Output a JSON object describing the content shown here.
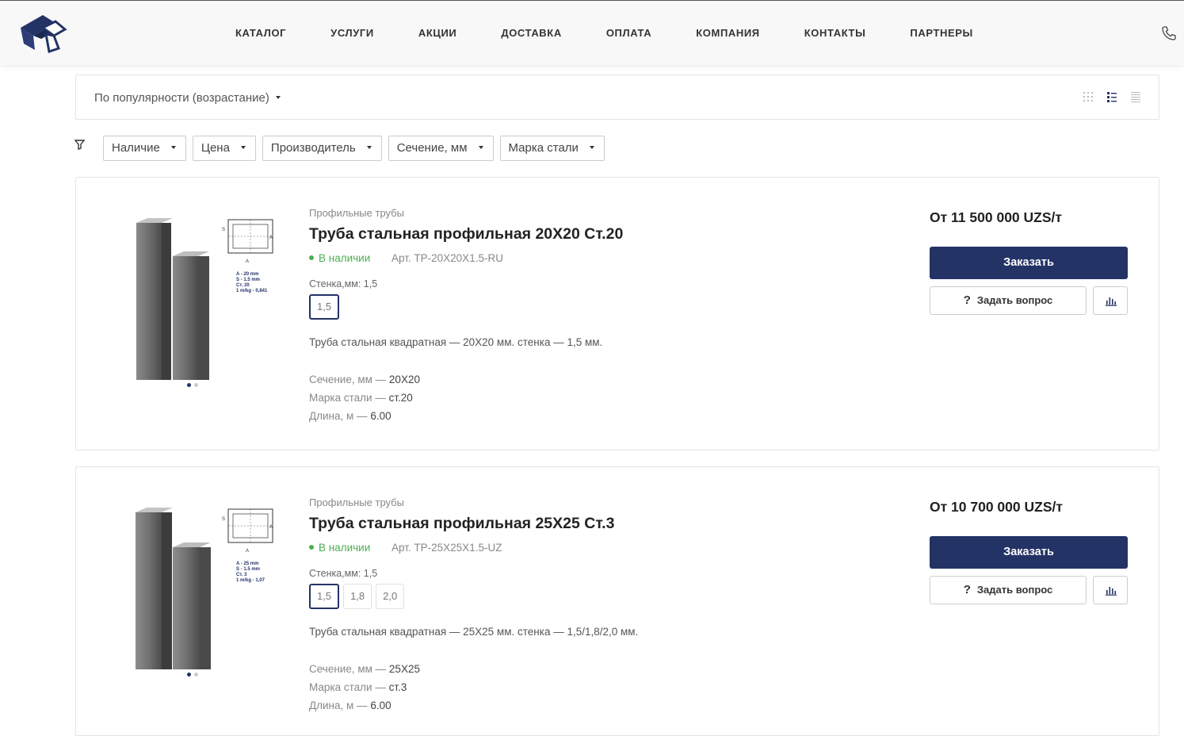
{
  "nav": {
    "items": [
      "КАТАЛОГ",
      "УСЛУГИ",
      "АКЦИИ",
      "ДОСТАВКА",
      "ОПЛАТА",
      "КОМПАНИЯ",
      "КОНТАКТЫ",
      "ПАРТНЕРЫ"
    ]
  },
  "sort": {
    "label": "По популярности (возрастание)",
    "views": [
      "grid-view-icon",
      "list-view-icon",
      "compact-list-icon"
    ],
    "active_view": "list-view-icon"
  },
  "filters": [
    "Наличие",
    "Цена",
    "Производитель",
    "Сечение, мм",
    "Марка стали"
  ],
  "colors": {
    "primary": "#243366",
    "in_stock": "#4caf50"
  },
  "products": [
    {
      "category": "Профильные трубы",
      "title": "Труба стальная профильная 20Х20 Ст.20",
      "stock": "В наличии",
      "article": "Арт. TP-20X20X1.5-RU",
      "prop_label": "Стенка,мм: 1,5",
      "variants": [
        "1,5"
      ],
      "selected_variant": "1,5",
      "description": "Труба стальная квадратная — 20Х20 мм. стенка — 1,5 мм.",
      "specs": [
        {
          "label": "Сечение, мм — ",
          "value": "20Х20"
        },
        {
          "label": "Марка стали — ",
          "value": "ст.20"
        },
        {
          "label": "Длина, м — ",
          "value": "6.00"
        }
      ],
      "image_caption": [
        "A - 20 mm",
        "S - 1.5 mm",
        "Ст. 20",
        "1 m/kg - 0,841"
      ],
      "price": "От 11 500 000 UZS/т",
      "order_label": "Заказать",
      "ask_label": "Задать вопрос"
    },
    {
      "category": "Профильные трубы",
      "title": "Труба стальная профильная 25Х25 Ст.3",
      "stock": "В наличии",
      "article": "Арт. TP-25X25X1.5-UZ",
      "prop_label": "Стенка,мм: 1,5",
      "variants": [
        "1,5",
        "1,8",
        "2,0"
      ],
      "selected_variant": "1,5",
      "description": "Труба стальная квадратная — 25Х25 мм. стенка — 1,5/1,8/2,0 мм.",
      "specs": [
        {
          "label": "Сечение, мм — ",
          "value": "25Х25"
        },
        {
          "label": "Марка стали — ",
          "value": "ст.3"
        },
        {
          "label": "Длина, м — ",
          "value": "6.00"
        }
      ],
      "image_caption": [
        "A - 25 mm",
        "S - 1.5 mm",
        "Ст. 3",
        "1 m/kg - 1,07"
      ],
      "price": "От 10 700 000 UZS/т",
      "order_label": "Заказать",
      "ask_label": "Задать вопрос"
    }
  ]
}
